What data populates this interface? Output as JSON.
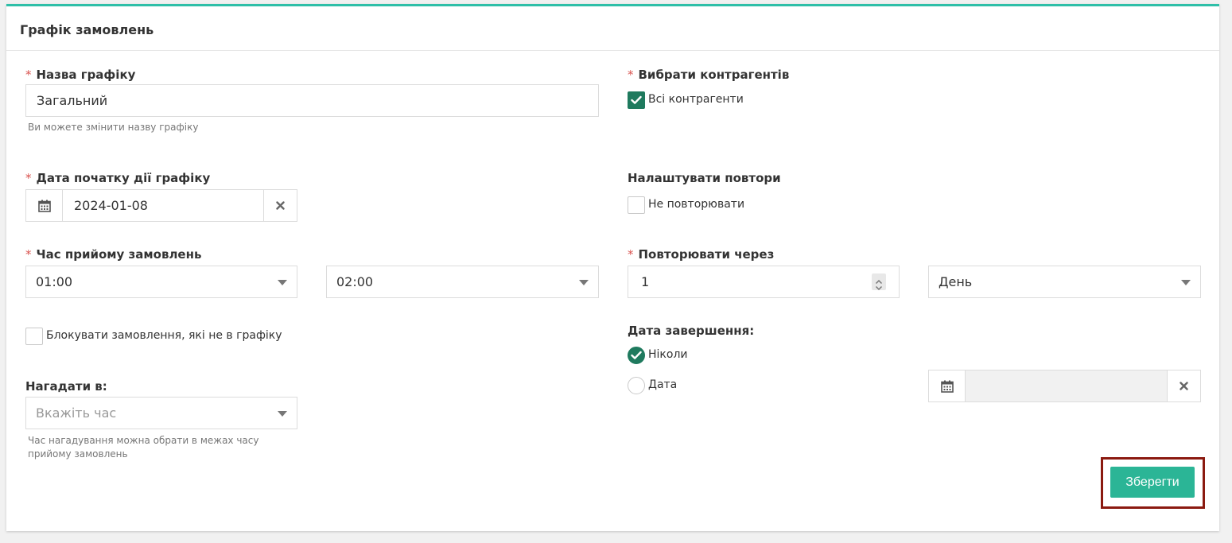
{
  "panel": {
    "title": "Графік замовлень"
  },
  "form": {
    "name": {
      "label": "Назва графіку",
      "value": "Загальний",
      "help": "Ви можете змінити назву графіку"
    },
    "start_date": {
      "label": "Дата початку дії графіку",
      "value": "2024-01-08"
    },
    "order_time": {
      "label": "Час прийому замовлень",
      "from": "01:00",
      "to": "02:00"
    },
    "block_orders": {
      "label": "Блокувати замовлення, які не в графіку",
      "checked": false
    },
    "remind": {
      "label": "Нагадати в:",
      "placeholder": "Вкажіть час",
      "help": "Час нагадування можна обрати в межах часу прийому замовлень"
    },
    "contractors": {
      "label": "Вибрати контрагентів",
      "all_label": "Всі контрагенти",
      "all_checked": true
    },
    "repeats": {
      "label": "Налаштувати повтори",
      "no_repeat_label": "Не повторювати",
      "no_repeat_checked": false
    },
    "repeat_every": {
      "label": "Повторювати через",
      "value": "1",
      "unit": "День"
    },
    "end_date": {
      "label": "Дата завершення:",
      "never_label": "Ніколи",
      "never_selected": true,
      "date_label": "Дата",
      "date_selected": false,
      "date_value": ""
    }
  },
  "actions": {
    "save_label": "Зберегти"
  },
  "colors": {
    "accent": "#2fbfa8",
    "check_green": "#1f7a5e",
    "button": "#2bb596",
    "required": "#d9534f",
    "highlight_frame": "#8b1a10"
  }
}
